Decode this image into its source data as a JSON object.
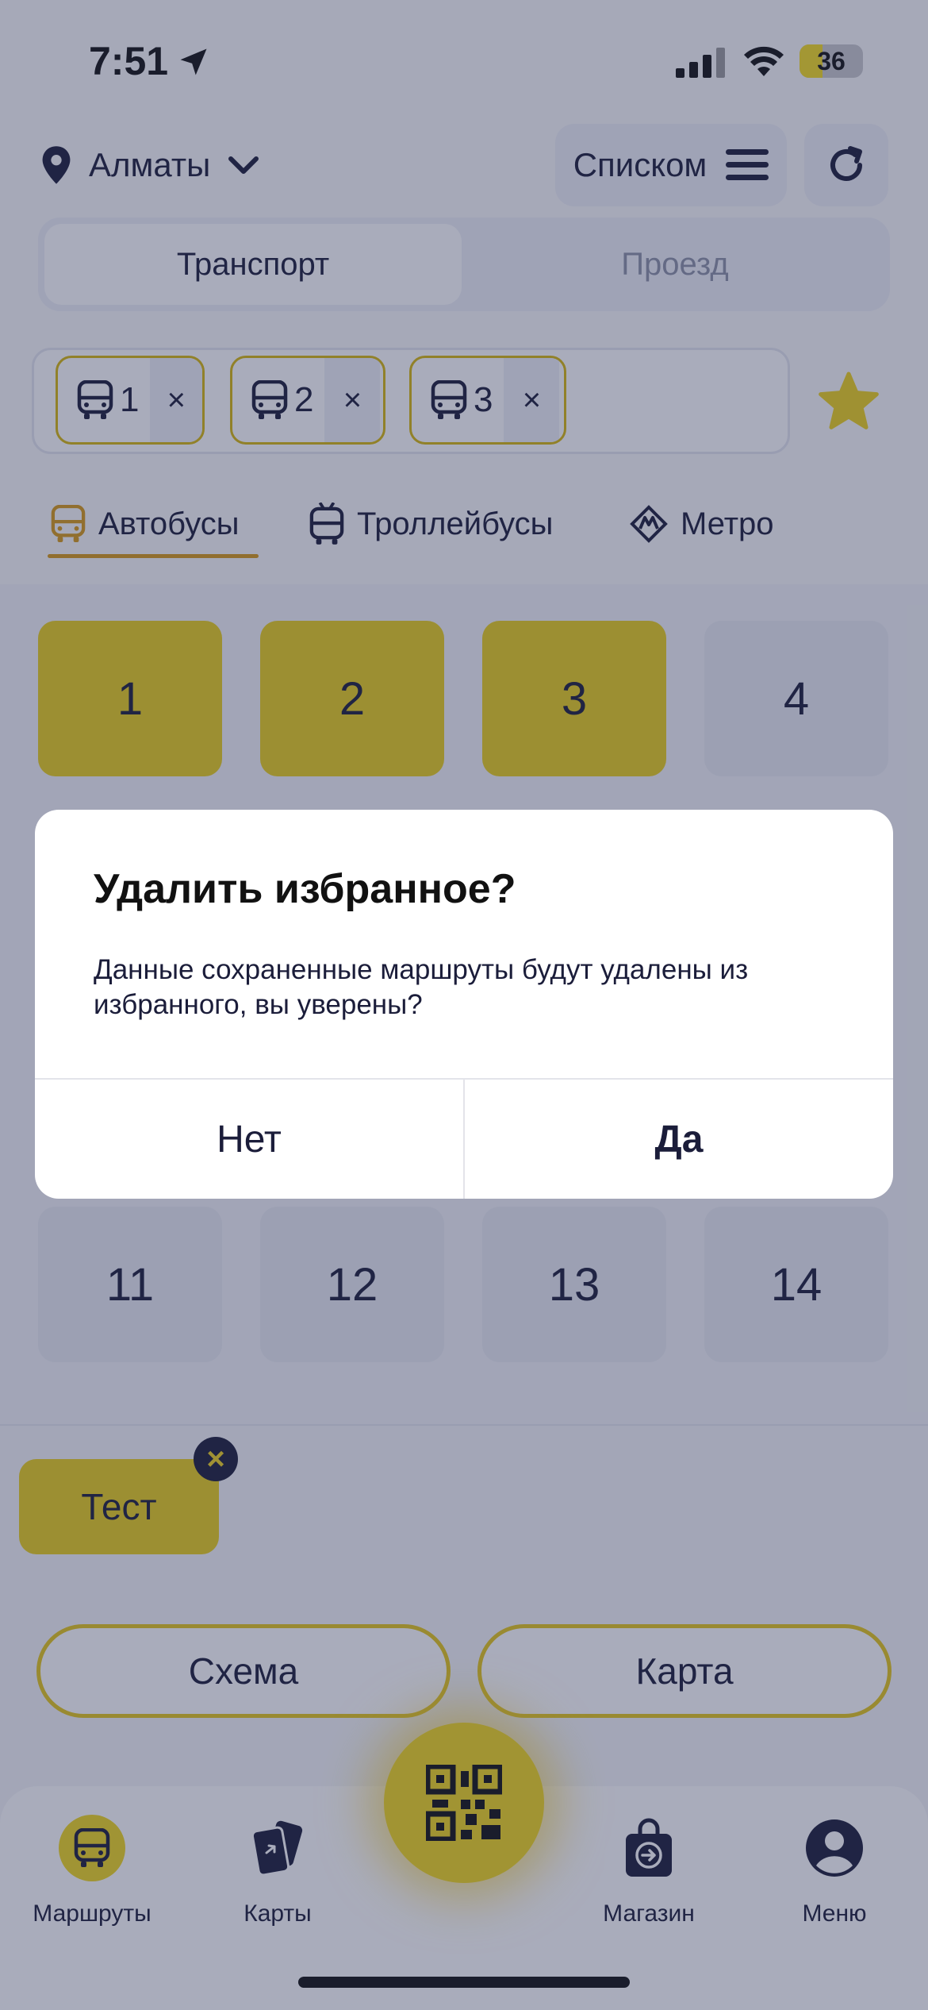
{
  "status": {
    "time": "7:51",
    "battery": "36",
    "battery_fraction": 0.36
  },
  "header": {
    "city": "Алматы",
    "list_label": "Списком"
  },
  "segments": {
    "active": "Транспорт",
    "inactive": "Проезд"
  },
  "favorites": {
    "chips": [
      {
        "number": "1"
      },
      {
        "number": "2"
      },
      {
        "number": "3"
      }
    ],
    "remove_symbol": "×"
  },
  "tabs": [
    {
      "label": "Автобусы"
    },
    {
      "label": "Троллейбусы"
    },
    {
      "label": "Метро"
    }
  ],
  "routes_grid": {
    "row1": [
      {
        "number": "1",
        "selected": true
      },
      {
        "number": "2",
        "selected": true
      },
      {
        "number": "3",
        "selected": true
      },
      {
        "number": "4",
        "selected": false
      }
    ],
    "row3": [
      {
        "number": "11"
      },
      {
        "number": "12"
      },
      {
        "number": "13"
      },
      {
        "number": "14"
      }
    ]
  },
  "saved": {
    "label": "Тест",
    "close_symbol": "×"
  },
  "actions": {
    "scheme": "Схема",
    "map": "Карта"
  },
  "tabbar": {
    "items": [
      {
        "label": "Маршруты",
        "icon": "bus-icon"
      },
      {
        "label": "Карты",
        "icon": "cards-icon"
      },
      {
        "label": "Магазин",
        "icon": "shop-bag-icon"
      },
      {
        "label": "Меню",
        "icon": "user-icon"
      }
    ],
    "center_icon": "qr-code-icon"
  },
  "dialog": {
    "title": "Удалить избранное?",
    "message": "Данные сохраненные маршруты будут удалены из избранного, вы уверены?",
    "no_label": "Нет",
    "yes_label": "Да"
  },
  "colors": {
    "accent_yellow": "#e9cf1b",
    "navy": "#1b1d3a",
    "orange": "#d89a17"
  }
}
